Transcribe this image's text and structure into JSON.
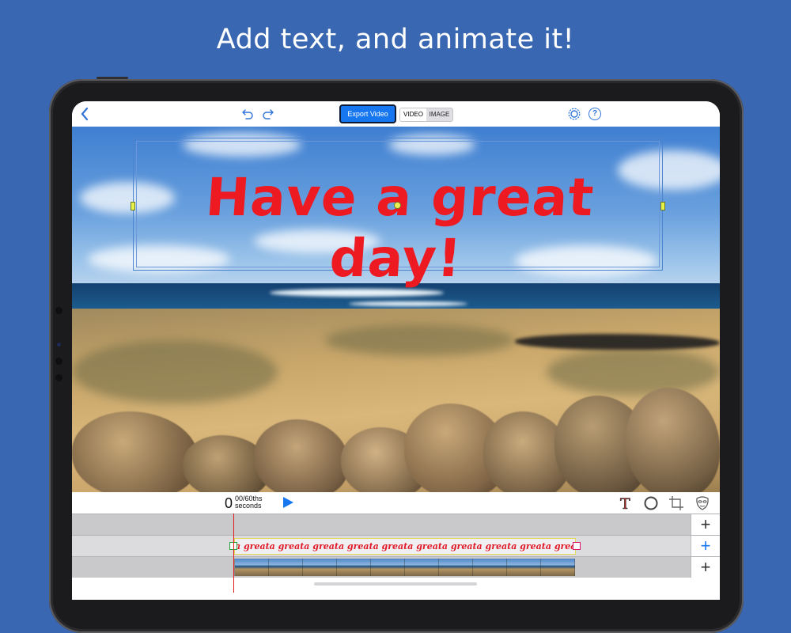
{
  "headline": "Add text, and animate it!",
  "toolbar": {
    "back_icon": "chevron-left-icon",
    "undo_icon": "undo-icon",
    "redo_icon": "redo-icon",
    "export_label": "Export Video",
    "segment": {
      "video": "VIDEO",
      "image": "IMAGE",
      "selected": "VIDEO"
    },
    "settings_icon": "gear-icon",
    "help_label": "?"
  },
  "canvas": {
    "overlay_text": "Have a great day!",
    "text_color": "#ee1a22"
  },
  "timeline": {
    "time_value": "0",
    "time_fraction": "00/60ths",
    "time_unit": "seconds",
    "tools": [
      "text-tool-icon",
      "circle-tool-icon",
      "crop-icon",
      "mask-icon"
    ],
    "text_clip_label": "a greata greata greata greata greata greata greata greata greata greata grea",
    "add_label": "+"
  },
  "colors": {
    "background": "#3a67b1",
    "accent": "#1677f0",
    "playhead": "#e11c1c"
  }
}
